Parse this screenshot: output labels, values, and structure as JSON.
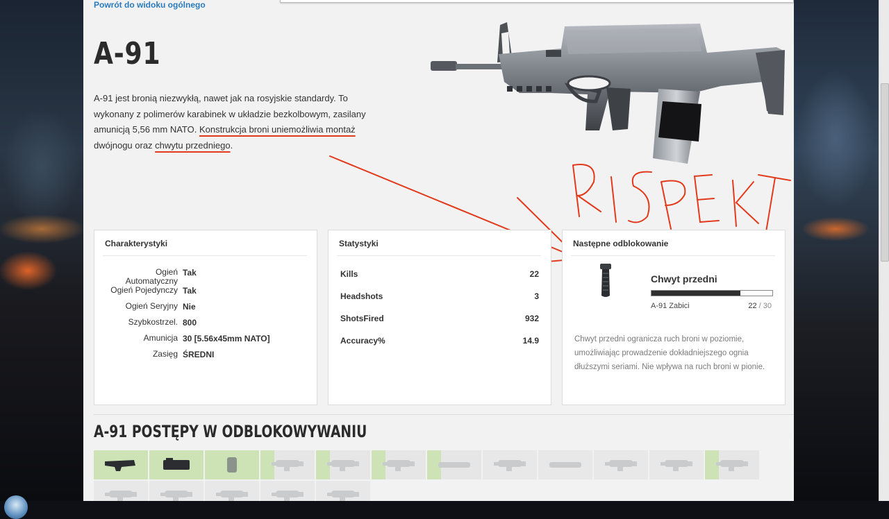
{
  "nav": {
    "back_link": "Powrót do widoku ogólnego"
  },
  "weapon": {
    "name": "A-91",
    "description": {
      "part1": "A-91 jest bronią niezwykłą, nawet jak na rosyjskie standardy. To wykonany z polimerów karabinek w układzie bezkolbowym, zasilany amunicją 5,56 mm NATO. ",
      "underlined1": "Konstrukcja broni uniemożliwia montaż",
      "part2": " dwójnogu oraz ",
      "underlined2": "chwytu przedniego",
      "part3": "."
    }
  },
  "annotation": {
    "text": "RISPEKT",
    "color": "#e23a1a"
  },
  "characteristics": {
    "title": "Charakterystyki",
    "rows": [
      {
        "label": "Ogień Automatyczny",
        "value": "Tak"
      },
      {
        "label": "Ogień Pojedynczy",
        "value": "Tak"
      },
      {
        "label": "Ogień Seryjny",
        "value": "Nie"
      },
      {
        "label": "Szybkostrzel.",
        "value": "800"
      },
      {
        "label": "Amunicja",
        "value": "30 [5.56x45mm NATO]"
      },
      {
        "label": "Zasięg",
        "value": "ŚREDNI"
      }
    ]
  },
  "statistics": {
    "title": "Statystyki",
    "rows": [
      {
        "label": "Kills",
        "value": "22"
      },
      {
        "label": "Headshots",
        "value": "3"
      },
      {
        "label": "ShotsFired",
        "value": "932"
      },
      {
        "label": "Accuracy%",
        "value": "14.9"
      }
    ]
  },
  "next_unlock": {
    "title": "Następne odblokowanie",
    "name": "Chwyt przedni",
    "progress_label": "A-91 Zabici",
    "current": "22",
    "separator": " / ",
    "total": "30",
    "progress_fraction": 0.733,
    "description": "Chwyt przedni ogranicza ruch broni w poziomie, umożliwiając prowadzenie dokładniejszego ognia dłuższymi seriami. Nie wpływa na ruch broni w pionie."
  },
  "progress_section": {
    "title": "A-91 POSTĘPY W ODBLOKOWYWANIU",
    "tiles": [
      {
        "icon": "foregrip-rail-icon",
        "state": "unlocked"
      },
      {
        "icon": "sight-icon",
        "state": "unlocked"
      },
      {
        "icon": "grip-icon",
        "state": "unlocked"
      },
      {
        "icon": "scope-icon",
        "state": "partial"
      },
      {
        "icon": "scope-icon",
        "state": "partial"
      },
      {
        "icon": "scope-icon",
        "state": "partial"
      },
      {
        "icon": "suppressor-icon",
        "state": "partial"
      },
      {
        "icon": "scope-icon",
        "state": "locked"
      },
      {
        "icon": "barrel-icon",
        "state": "locked"
      },
      {
        "icon": "scope-icon",
        "state": "locked"
      },
      {
        "icon": "scope-icon",
        "state": "locked"
      },
      {
        "icon": "scope-icon",
        "state": "partial"
      },
      {
        "icon": "scope-icon",
        "state": "locked"
      },
      {
        "icon": "scope-icon",
        "state": "locked"
      },
      {
        "icon": "scope-icon",
        "state": "locked"
      },
      {
        "icon": "scope-icon",
        "state": "locked"
      },
      {
        "icon": "scope-icon",
        "state": "locked"
      }
    ]
  }
}
